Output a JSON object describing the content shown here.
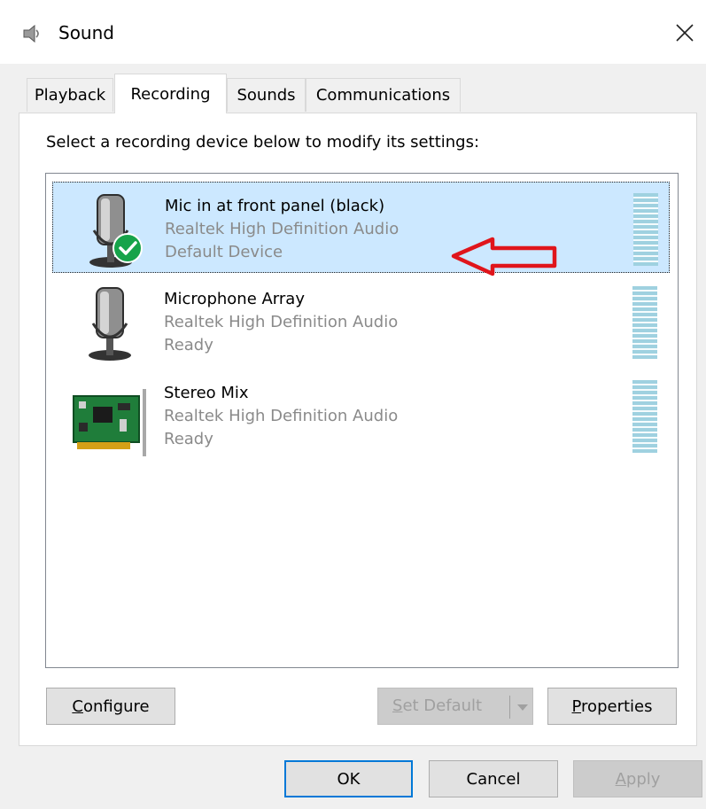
{
  "window": {
    "title": "Sound",
    "close_glyph": "✕",
    "icon": "speaker-icon"
  },
  "tabs": [
    {
      "label": "Playback",
      "active": false
    },
    {
      "label": "Recording",
      "active": true
    },
    {
      "label": "Sounds",
      "active": false
    },
    {
      "label": "Communications",
      "active": false
    }
  ],
  "instructions": "Select a recording device below to modify its settings:",
  "devices": [
    {
      "name": "Mic in at front panel (black)",
      "driver": "Realtek High Definition Audio",
      "status": "Default Device",
      "icon": "microphone-icon",
      "default": true,
      "selected": true
    },
    {
      "name": "Microphone Array",
      "driver": "Realtek High Definition Audio",
      "status": "Ready",
      "icon": "microphone-icon",
      "default": false,
      "selected": false
    },
    {
      "name": "Stereo Mix",
      "driver": "Realtek High Definition Audio",
      "status": "Ready",
      "icon": "sound-card-icon",
      "default": false,
      "selected": false
    }
  ],
  "buttons": {
    "configure_first": "C",
    "configure_rest": "onfigure",
    "set_default_first": "S",
    "set_default_rest": "et Default",
    "properties_first": "P",
    "properties_rest": "roperties",
    "ok": "OK",
    "cancel": "Cancel",
    "apply_first": "A",
    "apply_rest": "pply"
  },
  "colors": {
    "selection": "#cce8ff",
    "default_check": "#16a34a",
    "annotation_arrow": "#e0151b",
    "level_meter": "#9fd1e0"
  }
}
